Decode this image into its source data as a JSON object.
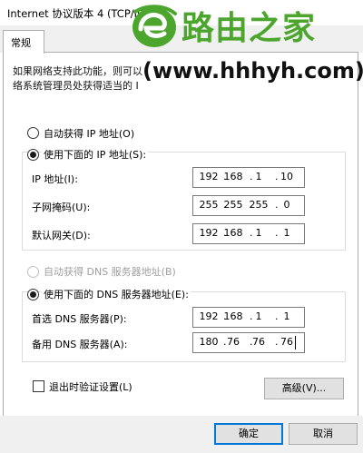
{
  "window": {
    "title": "Internet 协议版本 4 (TCP/IPv4"
  },
  "tabs": [
    {
      "label": "常规"
    }
  ],
  "description": {
    "line1": "如果网络支持此功能，则可以",
    "line2": "络系统管理员处获得适当的 I"
  },
  "ip_section": {
    "auto_option": "自动获得 IP 地址(O)",
    "manual_option": "使用下面的 IP 地址(S):",
    "manual_selected": true,
    "fields": [
      {
        "label": "IP 地址(I):",
        "octets": [
          "192",
          "168",
          "1",
          "10"
        ]
      },
      {
        "label": "子网掩码(U):",
        "octets": [
          "255",
          "255",
          "255",
          "0"
        ]
      },
      {
        "label": "默认网关(D):",
        "octets": [
          "192",
          "168",
          "1",
          "1"
        ]
      }
    ]
  },
  "dns_section": {
    "auto_option": "自动获得 DNS 服务器地址(B)",
    "auto_disabled": true,
    "manual_option": "使用下面的 DNS 服务器地址(E):",
    "manual_selected": true,
    "fields": [
      {
        "label": "首选 DNS 服务器(P):",
        "octets": [
          "192",
          "168",
          "1",
          "1"
        ]
      },
      {
        "label": "备用 DNS 服务器(A):",
        "octets": [
          "180",
          "76",
          "76",
          "76"
        ]
      }
    ]
  },
  "validate_checkbox": {
    "label": "退出时验证设置(L)",
    "checked": false
  },
  "buttons": {
    "advanced": "高级(V)...",
    "ok": "确定",
    "cancel": "取消"
  },
  "watermark": {
    "name": "路由之家",
    "url": "(www.hhhyh.com)",
    "color": "#4ca62d"
  }
}
